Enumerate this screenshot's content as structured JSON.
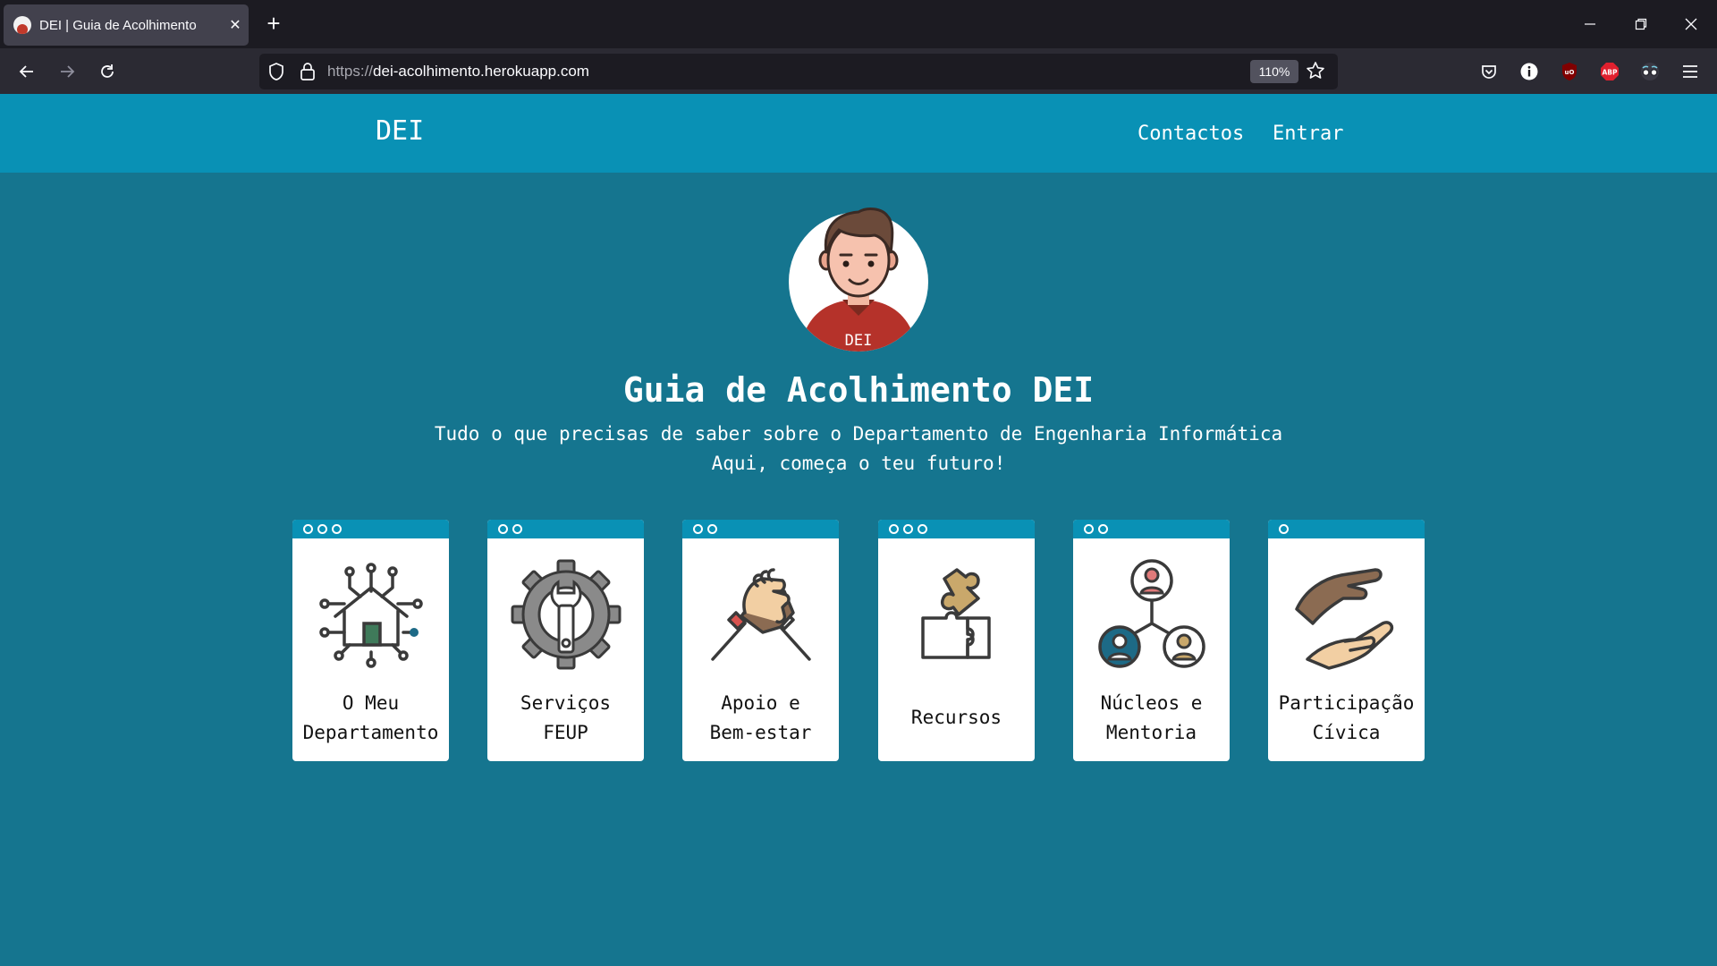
{
  "browser": {
    "tab_title": "DEI | Guia de Acolhimento",
    "url_protocol": "https://",
    "url_host": "dei-acolhimento.herokuapp.com",
    "zoom": "110%",
    "extensions": [
      "pocket-icon",
      "info-icon",
      "ublock-icon",
      "adblock-plus-icon",
      "glasses-icon",
      "menu-icon"
    ],
    "abp_label": "ABP",
    "ublock_label": "uO"
  },
  "site": {
    "brand": "DEI",
    "nav": {
      "contacts": "Contactos",
      "login": "Entrar"
    }
  },
  "hero": {
    "avatar_badge": "DEI",
    "title": "Guia de Acolhimento DEI",
    "subtitle_line1": "Tudo o que precisas de saber sobre o Departamento de Engenharia Informática",
    "subtitle_line2": "Aqui, começa o teu futuro!"
  },
  "cards": [
    {
      "line1": "O Meu",
      "line2": "Departamento",
      "dots": 3,
      "icon": "house-circuit-icon"
    },
    {
      "line1": "Serviços",
      "line2": "FEUP",
      "dots": 2,
      "icon": "gear-wrench-icon"
    },
    {
      "line1": "Apoio e",
      "line2": "Bem-estar",
      "dots": 2,
      "icon": "handshake-icon"
    },
    {
      "line1": "Recursos",
      "line2": "",
      "dots": 3,
      "icon": "puzzle-icon"
    },
    {
      "line1": "Núcleos e",
      "line2": "Mentoria",
      "dots": 2,
      "icon": "network-people-icon"
    },
    {
      "line1": "Participação",
      "line2": "Cívica",
      "dots": 1,
      "icon": "hands-icon"
    }
  ],
  "colors": {
    "header": "#0991b5",
    "page": "#15758f",
    "card": "#ffffff"
  }
}
